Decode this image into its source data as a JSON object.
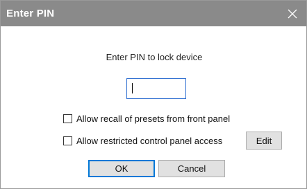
{
  "dialog": {
    "title": "Enter PIN",
    "prompt": "Enter PIN to lock device",
    "pin_value": "",
    "options": [
      {
        "label": "Allow recall of presets from front panel",
        "checked": false
      },
      {
        "label": "Allow restricted control panel access",
        "checked": false
      }
    ],
    "edit_label": "Edit",
    "ok_label": "OK",
    "cancel_label": "Cancel"
  },
  "icons": {
    "close": "close-icon"
  },
  "colors": {
    "titlebar": "#8a8a8a",
    "focus_border": "#2f6fd1",
    "default_button": "#0078d7"
  }
}
